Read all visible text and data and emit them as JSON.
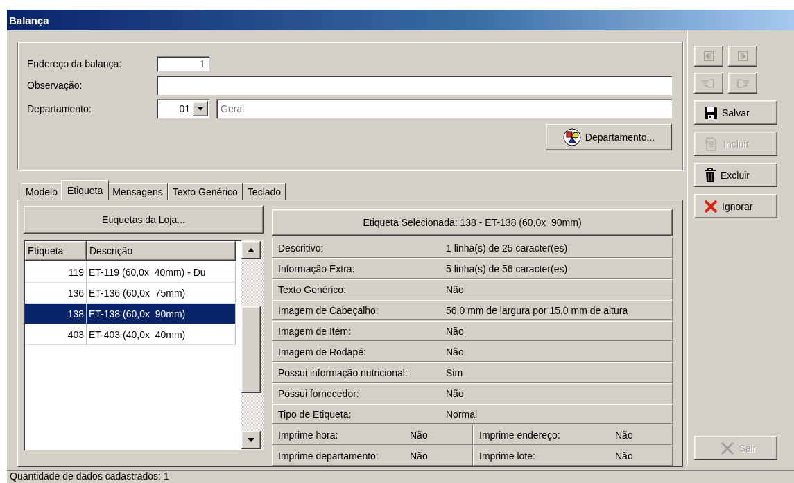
{
  "window": {
    "title": "Balança"
  },
  "form": {
    "address": {
      "label": "Endereço da balança:",
      "value": "1"
    },
    "observation": {
      "label": "Observação:"
    },
    "department": {
      "label": "Departamento:",
      "code": "01",
      "name": "Geral"
    },
    "department_button": "Departamento..."
  },
  "tabs": [
    {
      "label": "Modelo",
      "selected": false
    },
    {
      "label": "Etiqueta",
      "selected": true
    },
    {
      "label": "Mensagens",
      "selected": false
    },
    {
      "label": "Texto Genérico",
      "selected": false
    },
    {
      "label": "Teclado",
      "selected": false
    }
  ],
  "store_labels_button": "Etiquetas da Loja...",
  "labels_table": {
    "columns": [
      "Etiqueta",
      "Descrição"
    ],
    "rows": [
      {
        "code": "119",
        "description": "ET-119 (60,0x  40mm) - Du",
        "selected": false
      },
      {
        "code": "136",
        "description": "ET-136 (60,0x  75mm)",
        "selected": false
      },
      {
        "code": "138",
        "description": "ET-138 (60,0x  90mm)",
        "selected": true
      },
      {
        "code": "403",
        "description": "ET-403 (40,0x  40mm)",
        "selected": false
      }
    ]
  },
  "selected_label_button": "Etiqueta Selecionada: 138 - ET-138 (60,0x  90mm)",
  "details": [
    {
      "label": "Descritivo:",
      "value": "1 linha(s) de 25 caracter(es)"
    },
    {
      "label": "Informação Extra:",
      "value": "5 linha(s) de 56 caracter(es)"
    },
    {
      "label": "Texto Genérico:",
      "value": "Não"
    },
    {
      "label": "Imagem de Cabeçalho:",
      "value": "56,0 mm de largura por 15,0 mm de altura"
    },
    {
      "label": "Imagem de Item:",
      "value": "Não"
    },
    {
      "label": "Imagem de Rodapé:",
      "value": "Não"
    },
    {
      "label": "Possui informação nutricional:",
      "value": "Sim"
    },
    {
      "label": "Possui fornecedor:",
      "value": "Não"
    },
    {
      "label": "Tipo de Etiqueta:",
      "value": "Normal"
    }
  ],
  "print_options": [
    {
      "label": "Imprime hora:",
      "value": "Não"
    },
    {
      "label": "Imprime endereço:",
      "value": "Não"
    },
    {
      "label": "Imprime departamento:",
      "value": "Não"
    },
    {
      "label": "Imprime lote:",
      "value": "Não"
    }
  ],
  "toolbar": {
    "nav_buttons": [
      {
        "kind": "previous",
        "disabled": true
      },
      {
        "kind": "next",
        "disabled": true
      },
      {
        "kind": "point-left",
        "disabled": true
      },
      {
        "kind": "point-right",
        "disabled": true
      }
    ],
    "actions": [
      {
        "kind": "save",
        "label": "Salvar",
        "disabled": false
      },
      {
        "kind": "include",
        "label": "Incluir",
        "disabled": true
      },
      {
        "kind": "delete",
        "label": "Excluir",
        "disabled": false
      },
      {
        "kind": "cancel",
        "label": "Ignorar",
        "disabled": false
      }
    ],
    "exit": {
      "label": "Sair",
      "disabled": true
    }
  },
  "status_bar": "Quantidade de dados cadastrados: 1"
}
